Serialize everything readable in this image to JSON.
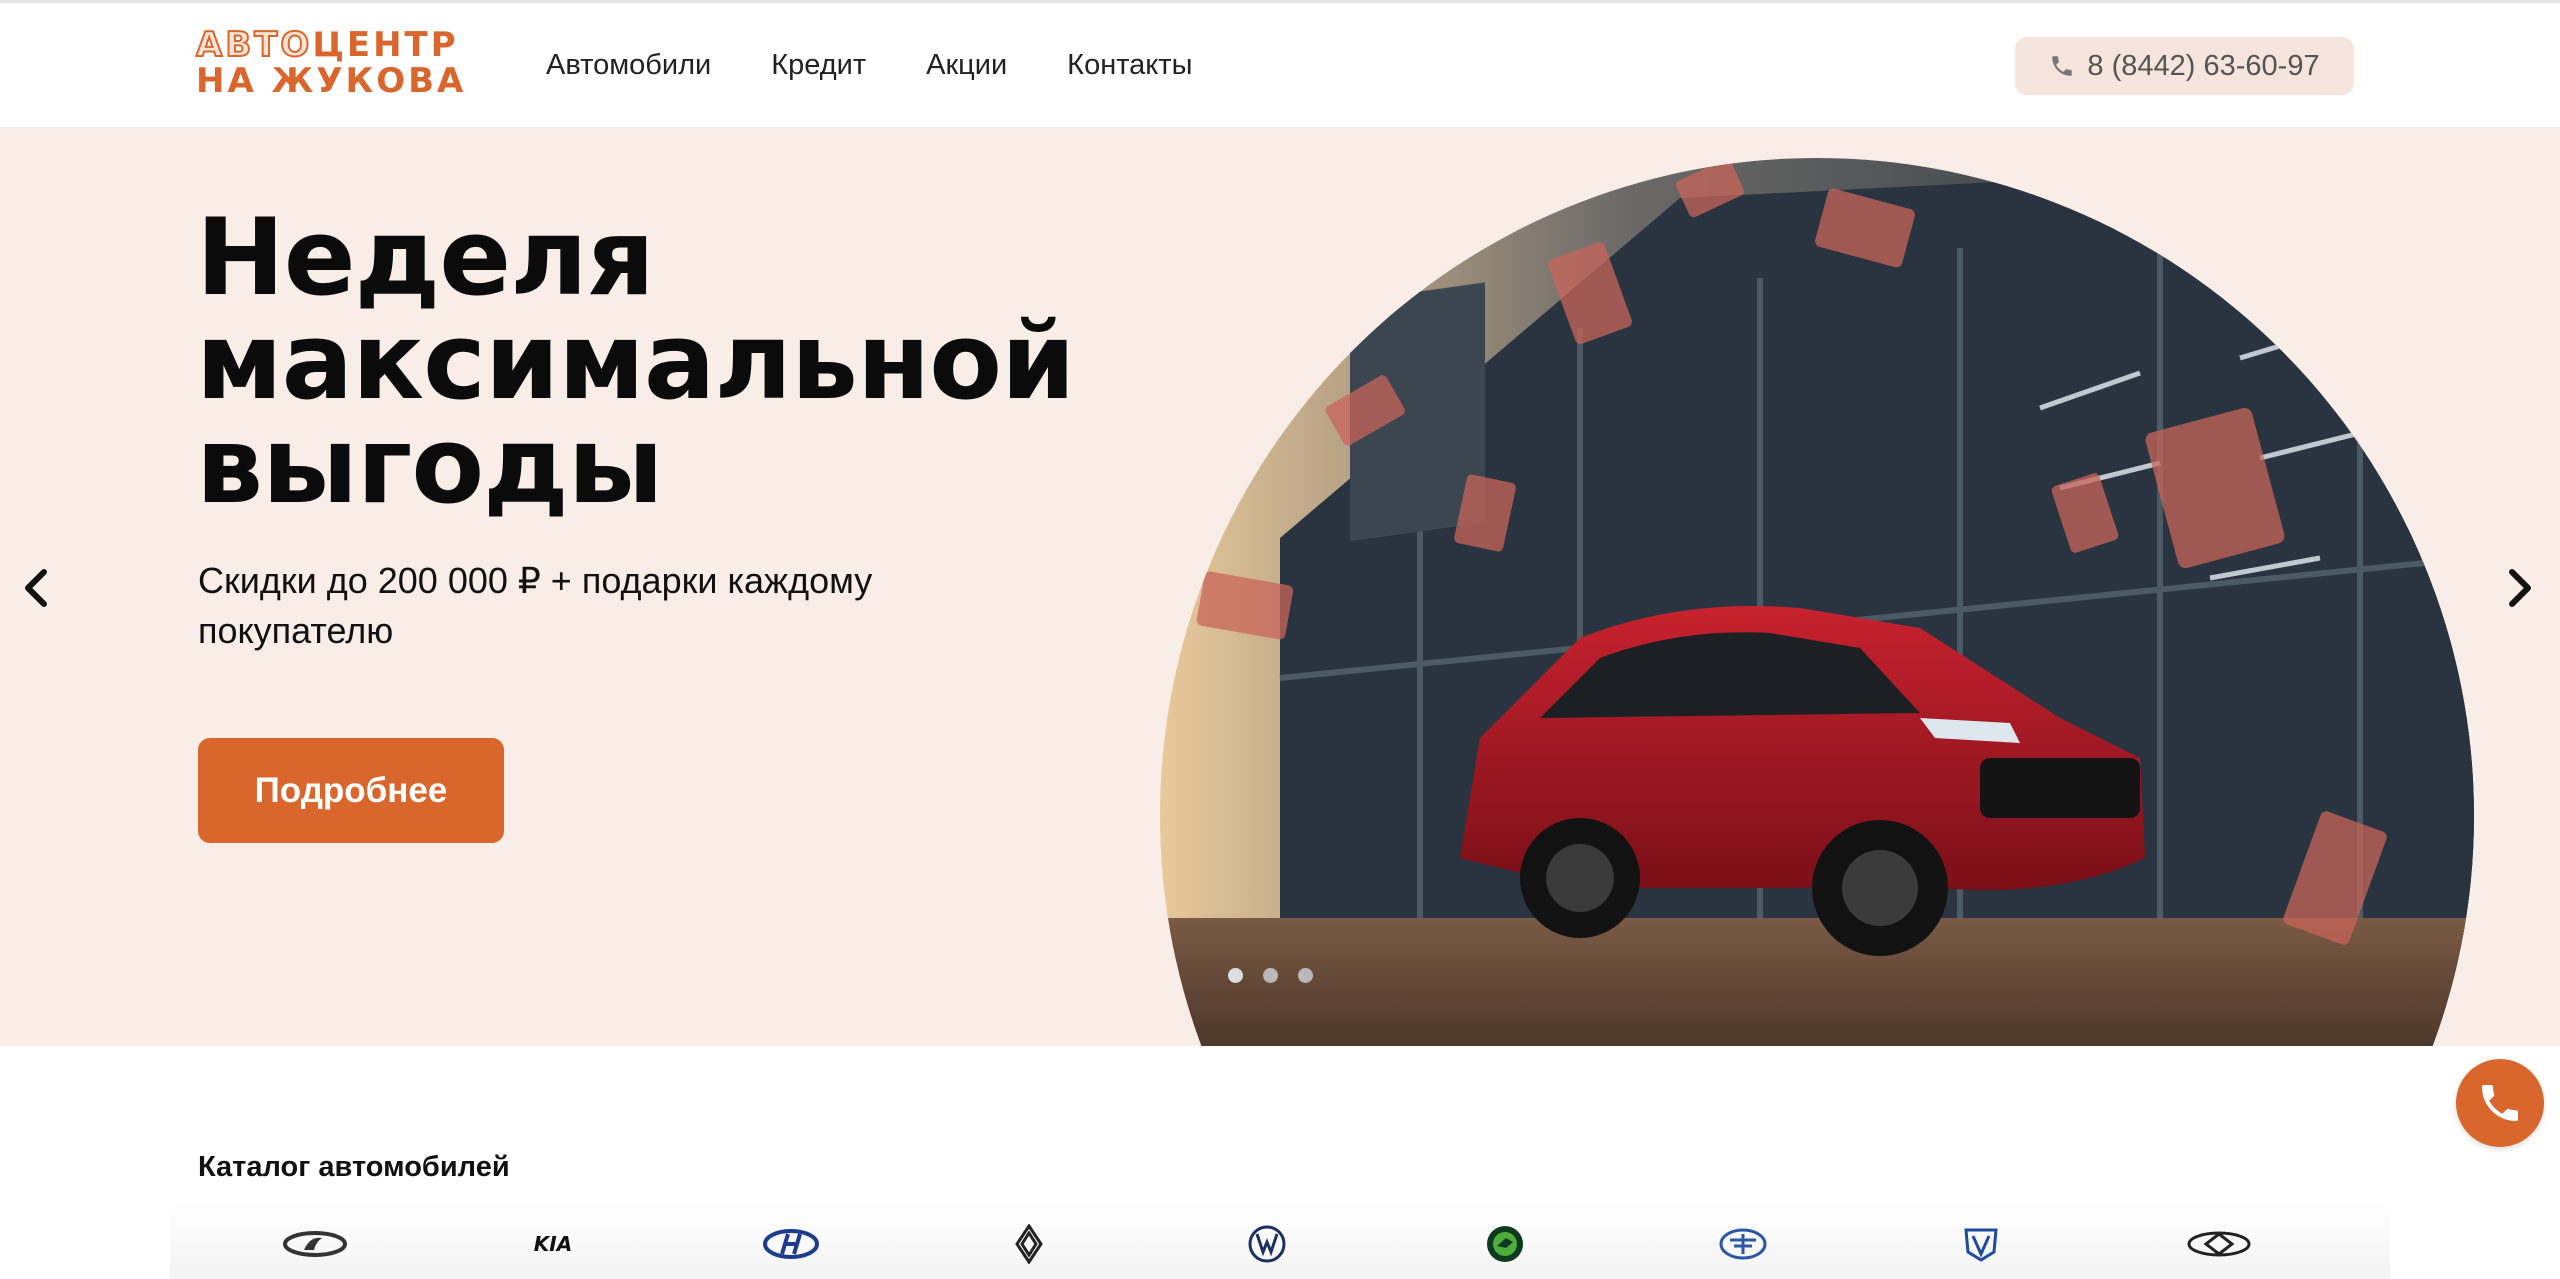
{
  "header": {
    "logo_line1_outline": "АВТО",
    "logo_line1_solid": "ЦЕНТР",
    "logo_line2": "НА ЖУКОВА",
    "nav": [
      {
        "label": "Автомобили"
      },
      {
        "label": "Кредит"
      },
      {
        "label": "Акции"
      },
      {
        "label": "Контакты"
      }
    ],
    "phone": "8 (8442) 63-60-97",
    "phone_icon": "phone-icon"
  },
  "hero": {
    "title_lines": [
      "Неделя",
      "максимальной",
      "выгоды"
    ],
    "subtitle": "Скидки до 200 000 ₽ + подарки каждому покупателю",
    "button_label": "Подробнее",
    "prev_icon": "chevron-left-icon",
    "next_icon": "chevron-right-icon",
    "slides_total": 3,
    "active_slide": 1
  },
  "catalog": {
    "title": "Каталог автомобилей",
    "brands": [
      {
        "icon": "lada-logo-icon"
      },
      {
        "icon": "kia-logo-icon"
      },
      {
        "icon": "hyundai-logo-icon"
      },
      {
        "icon": "renault-logo-icon"
      },
      {
        "icon": "volkswagen-logo-icon"
      },
      {
        "icon": "skoda-logo-icon"
      },
      {
        "icon": "faw-logo-icon"
      },
      {
        "icon": "changan-logo-icon"
      },
      {
        "icon": "chery-logo-icon"
      }
    ]
  },
  "colors": {
    "accent": "#d9662c",
    "hero_bg": "#f8ede7",
    "phone_pill_bg": "#f6e5dd",
    "text": "#111111"
  },
  "fab": {
    "icon": "phone-icon"
  }
}
